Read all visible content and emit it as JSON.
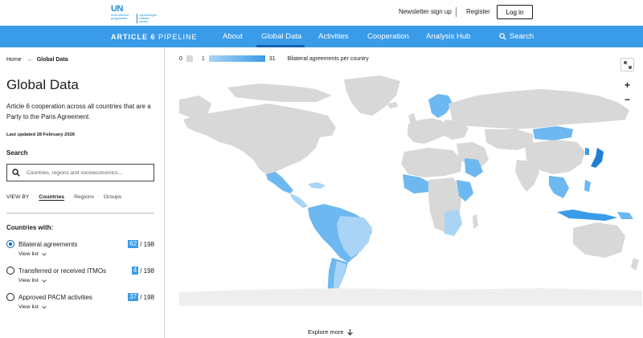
{
  "topbar": {
    "logo_text": "UN",
    "logo_sub": "environment programme",
    "logo_sub2": "copenhagen climate centre",
    "newsletter": "Newsletter sign up",
    "register": "Register",
    "login": "Log in"
  },
  "nav": {
    "brand_bold": "ARTICLE 6",
    "brand_light": " PIPELINE",
    "items": [
      "About",
      "Global Data",
      "Activities",
      "Cooperation",
      "Analysis Hub"
    ],
    "active_index": 1,
    "search": "Search"
  },
  "breadcrumb": {
    "home": "Home",
    "current": "Global Data"
  },
  "page": {
    "title": "Global Data",
    "description": "Article 6 cooperation across all countries that are a Party to the Paris Agreement.",
    "updated": "Last updated 28 February 2026"
  },
  "search": {
    "label": "Search",
    "placeholder": "Countries, regions and socioeconomics..."
  },
  "viewby": {
    "label": "VIEW BY",
    "tabs": [
      "Countries",
      "Regions",
      "Groups"
    ],
    "active": "Countries"
  },
  "countries_with": {
    "title": "Countries with:",
    "options": [
      {
        "label": "Bilateral agreements",
        "count": "62",
        "total": "/ 198",
        "view": "View list",
        "checked": true
      },
      {
        "label": "Transferred or received ITMOs",
        "count": "4",
        "total": "/ 198",
        "view": "View list",
        "checked": false
      },
      {
        "label": "Approved PACM activities",
        "count": "37",
        "total": "/ 198",
        "view": "View list",
        "checked": false
      }
    ]
  },
  "legend": {
    "zero": "0",
    "min": "1",
    "max": "31",
    "title": "Bilateral agreements per country"
  },
  "map": {
    "zoom_in": "+",
    "zoom_out": "−",
    "explore": "Explore more",
    "colors": {
      "none": "#d8d8d8",
      "low": "#a9d4f5",
      "mid": "#6db8f0",
      "high": "#3a9be8",
      "top": "#1e7fd6"
    }
  }
}
